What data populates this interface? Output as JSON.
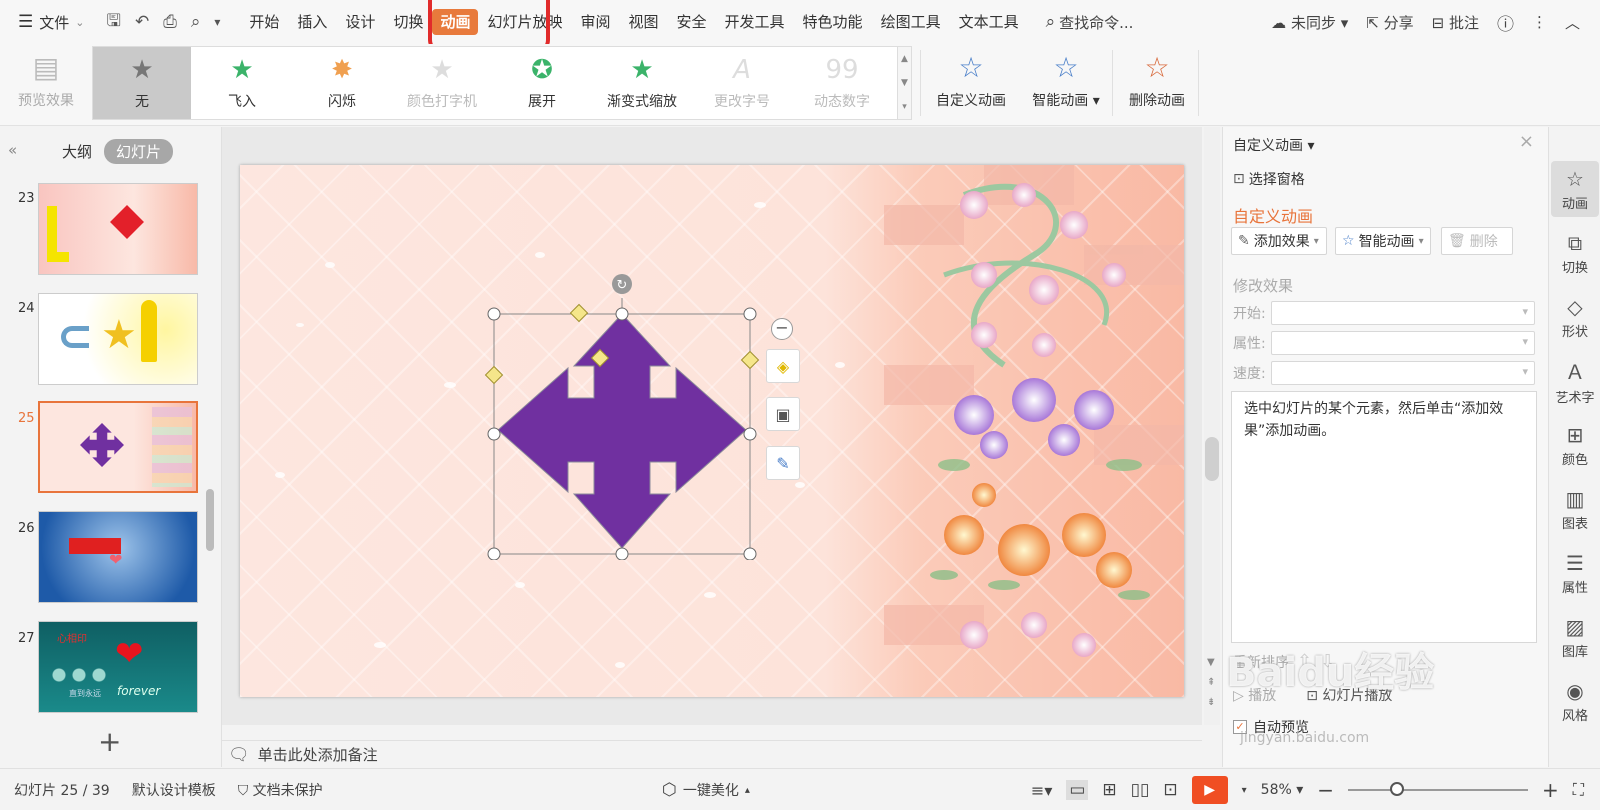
{
  "menubar": {
    "file_label": "文件",
    "menus": [
      "开始",
      "插入",
      "设计",
      "切换",
      "动画",
      "幻灯片放映",
      "审阅",
      "视图",
      "安全",
      "开发工具",
      "特色功能",
      "绘图工具",
      "文本工具"
    ],
    "active_menu": "动画",
    "search_label": "查找命令...",
    "sync_label": "未同步",
    "share_label": "分享",
    "comment_label": "批注"
  },
  "ribbon": {
    "preview_label": "预览效果",
    "gallery": [
      {
        "label": "无",
        "icon": "star-gray",
        "state": "selected"
      },
      {
        "label": "飞入",
        "icon": "star-fly",
        "state": "normal"
      },
      {
        "label": "闪烁",
        "icon": "star-flash",
        "state": "normal"
      },
      {
        "label": "颜色打字机",
        "icon": "star-typewriter",
        "state": "disabled"
      },
      {
        "label": "展开",
        "icon": "star-expand",
        "state": "normal"
      },
      {
        "label": "渐变式缩放",
        "icon": "star-zoom",
        "state": "normal"
      },
      {
        "label": "更改字号",
        "icon": "font-size",
        "state": "disabled"
      },
      {
        "label": "动态数字",
        "icon": "number-99",
        "state": "disabled"
      }
    ],
    "custom_anim_label": "自定义动画",
    "smart_anim_label": "智能动画",
    "delete_anim_label": "删除动画"
  },
  "leftpanel": {
    "tab_outline": "大纲",
    "tab_slides": "幻灯片",
    "slides": [
      {
        "num": "23",
        "selected": false
      },
      {
        "num": "24",
        "selected": false
      },
      {
        "num": "25",
        "selected": true
      },
      {
        "num": "26",
        "selected": false
      },
      {
        "num": "27",
        "selected": false
      }
    ],
    "slide27_title": "心相印",
    "slide27_sub": "直到永远",
    "slide27_word": "forever"
  },
  "notes": {
    "placeholder": "单击此处添加备注"
  },
  "rightpanel": {
    "title": "自定义动画",
    "select_pane": "选择窗格",
    "section_title": "自定义动画",
    "add_effect": "添加效果",
    "smart_anim": "智能动画",
    "delete": "删除",
    "modify_effect": "修改效果",
    "start_label": "开始:",
    "property_label": "属性:",
    "speed_label": "速度:",
    "info_text": "选中幻灯片的某个元素，然后单击“添加效果”添加动画。",
    "reorder_label": "重新排序",
    "play_label": "播放",
    "slideshow_label": "幻灯片播放",
    "auto_preview": "自动预览"
  },
  "rsidebar": {
    "items": [
      "动画",
      "切换",
      "形状",
      "艺术字",
      "颜色",
      "图表",
      "属性",
      "图库",
      "风格"
    ]
  },
  "statusbar": {
    "slide_info": "幻灯片 25 / 39",
    "template": "默认设计模板",
    "protect": "文档未保护",
    "beautify": "一键美化",
    "zoom": "58%"
  },
  "watermark": {
    "text": "Baidu经验",
    "url": "jingyan.baidu.com"
  },
  "colors": {
    "accent": "#e8743b",
    "shape_fill": "#7030a0",
    "play": "#f04e23",
    "highlight_box": "#e12b2b"
  }
}
